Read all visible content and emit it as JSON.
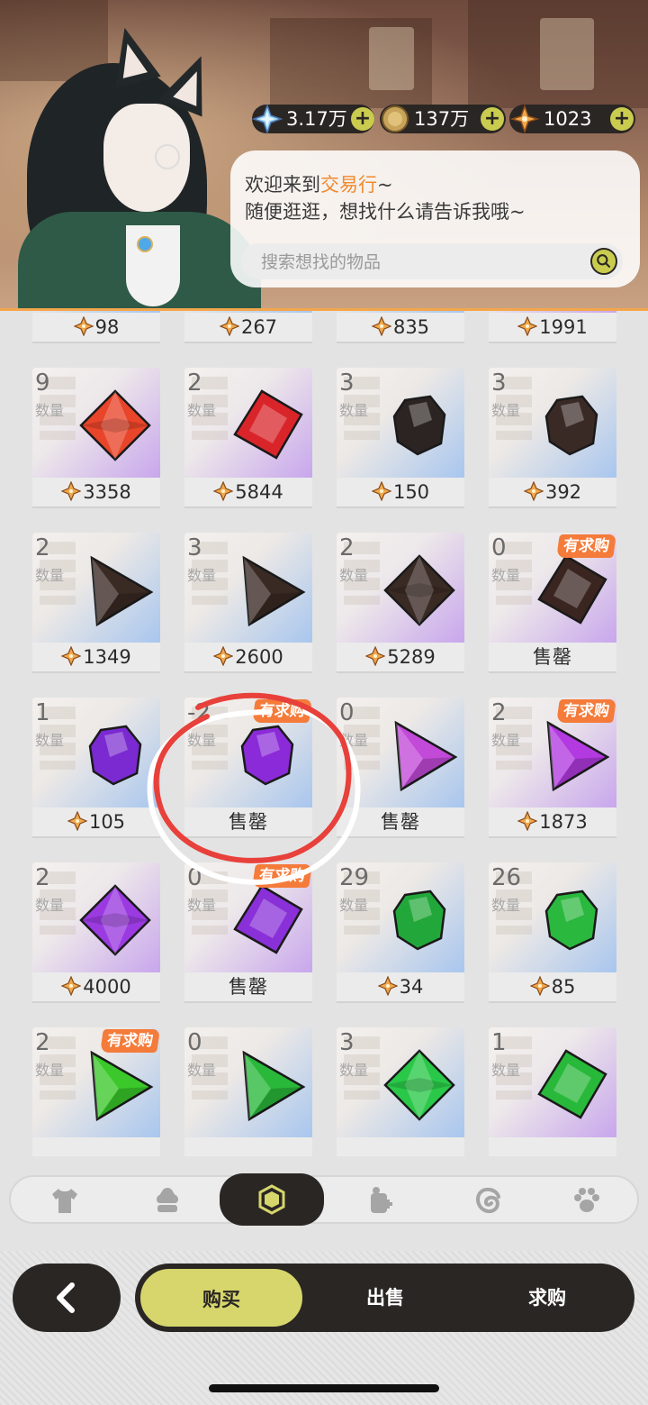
{
  "header": {
    "currencies": [
      {
        "icon": "crystal-icon",
        "value": "3.17万"
      },
      {
        "icon": "gold-coin-icon",
        "value": "137万"
      },
      {
        "icon": "star-shard-icon",
        "value": "1023"
      }
    ],
    "plus_label": "+"
  },
  "dialog": {
    "greeting_prefix": "欢迎来到",
    "greeting_highlight": "交易行",
    "greeting_suffix": "~",
    "line2": "随便逛逛，想找什么请告诉我哦~",
    "search_placeholder": "搜索想找的物品"
  },
  "grid": {
    "qty_label": "数量",
    "badge_label": "有求购",
    "sold_out_label": "售罄",
    "items": [
      {
        "qty": "",
        "price": "98",
        "gem": "red-gem-icon",
        "shape": "partial",
        "color": "#e0442a",
        "bg": "blue"
      },
      {
        "qty": "",
        "price": "267",
        "gem": "red-gem-icon",
        "shape": "partial",
        "color": "#e0442a",
        "bg": "blue"
      },
      {
        "qty": "",
        "price": "835",
        "gem": "orange-gem-icon",
        "shape": "partial",
        "color": "#f0782a",
        "bg": "blue"
      },
      {
        "qty": "",
        "price": "1991",
        "gem": "orange-gem-icon",
        "shape": "partial",
        "color": "#f0782a",
        "bg": "purple"
      },
      {
        "qty": "9",
        "price": "3358",
        "gem": "red-diamond-gem-icon",
        "shape": "diamond",
        "color": "#e8452a",
        "bg": "purple"
      },
      {
        "qty": "2",
        "price": "5844",
        "gem": "red-cube-gem-icon",
        "shape": "square",
        "color": "#d9252a",
        "bg": "purple"
      },
      {
        "qty": "3",
        "price": "150",
        "gem": "black-stone-icon",
        "shape": "stone",
        "color": "#2c2422",
        "bg": "blue"
      },
      {
        "qty": "3",
        "price": "392",
        "gem": "black-stone-icon",
        "shape": "stone",
        "color": "#3a2a26",
        "bg": "blue"
      },
      {
        "qty": "2",
        "price": "1349",
        "gem": "black-triangle-gem-icon",
        "shape": "triangle",
        "color": "#3a2a24",
        "bg": "blue"
      },
      {
        "qty": "3",
        "price": "2600",
        "gem": "black-triangle-gem-icon",
        "shape": "triangle",
        "color": "#3a2a24",
        "bg": "blue"
      },
      {
        "qty": "2",
        "price": "5289",
        "gem": "black-diamond-gem-icon",
        "shape": "diamond",
        "color": "#3a2a24",
        "bg": "purple"
      },
      {
        "qty": "0",
        "price": "",
        "sold_out": true,
        "badge": true,
        "gem": "black-cube-gem-icon",
        "shape": "square",
        "color": "#3a2520",
        "bg": "purple"
      },
      {
        "qty": "1",
        "price": "105",
        "gem": "purple-stone-icon",
        "shape": "stone",
        "color": "#7a2ad0",
        "bg": "blue"
      },
      {
        "qty": "-2",
        "price": "",
        "sold_out": true,
        "badge": true,
        "gem": "purple-stone-icon",
        "shape": "stone",
        "color": "#8a2ad8",
        "bg": "blue"
      },
      {
        "qty": "0",
        "price": "",
        "sold_out": true,
        "gem": "purple-triangle-gem-icon",
        "shape": "triangle",
        "color": "#c24ad8",
        "bg": "blue"
      },
      {
        "qty": "2",
        "price": "1873",
        "badge": true,
        "gem": "purple-triangle-gem-icon",
        "shape": "triangle",
        "color": "#b23ae0",
        "bg": "purple"
      },
      {
        "qty": "2",
        "price": "4000",
        "gem": "purple-diamond-gem-icon",
        "shape": "diamond",
        "color": "#9a3ae0",
        "bg": "purple"
      },
      {
        "qty": "0",
        "price": "",
        "sold_out": true,
        "badge": true,
        "gem": "purple-cube-gem-icon",
        "shape": "square",
        "color": "#8a30d8",
        "bg": "purple"
      },
      {
        "qty": "29",
        "price": "34",
        "gem": "green-stone-icon",
        "shape": "stone",
        "color": "#22a83a",
        "bg": "blue"
      },
      {
        "qty": "26",
        "price": "85",
        "gem": "green-stone-icon",
        "shape": "stone",
        "color": "#2ab83e",
        "bg": "blue"
      },
      {
        "qty": "2",
        "price": "",
        "badge": true,
        "gem": "green-triangle-gem-icon",
        "shape": "triangle",
        "color": "#3ac82a",
        "bg": "blue"
      },
      {
        "qty": "0",
        "price": "",
        "gem": "green-triangle-gem-icon",
        "shape": "triangle",
        "color": "#2ab83a",
        "bg": "blue"
      },
      {
        "qty": "3",
        "price": "",
        "gem": "green-diamond-gem-icon",
        "shape": "diamond",
        "color": "#2ac848",
        "bg": "blue"
      },
      {
        "qty": "1",
        "price": "",
        "gem": "green-cube-gem-icon",
        "shape": "square",
        "color": "#28b83a",
        "bg": "purple"
      }
    ]
  },
  "tabs": [
    {
      "name": "tab-clothing",
      "icon": "shirt-icon",
      "active": false
    },
    {
      "name": "tab-food",
      "icon": "dessert-icon",
      "active": false
    },
    {
      "name": "tab-gems",
      "icon": "gem-icon",
      "active": true
    },
    {
      "name": "tab-materials",
      "icon": "bag-icon",
      "active": false
    },
    {
      "name": "tab-dye",
      "icon": "swirl-icon",
      "active": false
    },
    {
      "name": "tab-pets",
      "icon": "paw-icon",
      "active": false
    }
  ],
  "actions": {
    "buy": "购买",
    "sell": "出售",
    "request": "求购"
  },
  "colors": {
    "accent_yellow": "#d6d66c",
    "badge_orange": "#f47b3a",
    "highlight_text": "#f08a2e",
    "dark": "#2a2624",
    "annotation_red": "#e8403a"
  }
}
